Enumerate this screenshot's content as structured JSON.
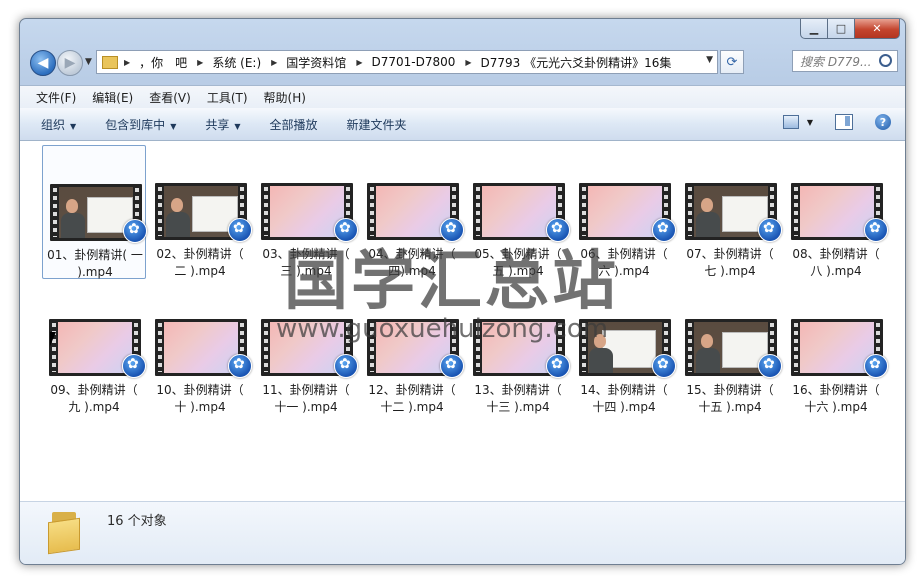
{
  "window": {
    "caption": {
      "minimize": "▁",
      "maximize": "□",
      "close": "✕"
    }
  },
  "nav": {
    "back_glyph": "◀",
    "forward_glyph": "▶",
    "address": [
      "，你　吧",
      "系统 (E:)",
      "国学资料馆",
      "D7701-D7800",
      "D7793 《元光六爻卦例精讲》16集"
    ],
    "search_placeholder": "搜索 D779..."
  },
  "menu": [
    "文件(F)",
    "编辑(E)",
    "查看(V)",
    "工具(T)",
    "帮助(H)"
  ],
  "commands": [
    "组织",
    "包含到库中",
    "共享",
    "全部播放",
    "新建文件夹"
  ],
  "files": [
    {
      "name": "01、卦例精讲( 一 ).mp4",
      "thumb": "person"
    },
    {
      "name": "02、卦例精讲（ 二 ).mp4",
      "thumb": "person"
    },
    {
      "name": "03、卦例精讲（ 三 ).mp4",
      "thumb": "gradient"
    },
    {
      "name": "04、卦例精讲（ 四).mp4",
      "thumb": "gradient"
    },
    {
      "name": "05、卦例精讲（ 五 ).mp4",
      "thumb": "gradient"
    },
    {
      "name": "06、卦例精讲（ 六 ).mp4",
      "thumb": "gradient"
    },
    {
      "name": "07、卦例精讲（ 七 ).mp4",
      "thumb": "person"
    },
    {
      "name": "08、卦例精讲（ 八 ).mp4",
      "thumb": "gradient"
    },
    {
      "name": "09、卦例精讲（ 九 ).mp4",
      "thumb": "gradient"
    },
    {
      "name": "10、卦例精讲（ 十 ).mp4",
      "thumb": "gradient"
    },
    {
      "name": "11、卦例精讲（ 十一 ).mp4",
      "thumb": "gradient"
    },
    {
      "name": "12、卦例精讲（ 十二 ).mp4",
      "thumb": "gradient"
    },
    {
      "name": "13、卦例精讲（ 十三 ).mp4",
      "thumb": "gradient"
    },
    {
      "name": "14、卦例精讲（ 十四 ).mp4",
      "thumb": "person2"
    },
    {
      "name": "15、卦例精讲（ 十五 ).mp4",
      "thumb": "person"
    },
    {
      "name": "16、卦例精讲（ 十六 ).mp4",
      "thumb": "gradient"
    }
  ],
  "details": {
    "count": "16 个对象"
  },
  "watermark": {
    "line1": "国学汇总站",
    "line2": "www.guoxuehuizong.com"
  }
}
